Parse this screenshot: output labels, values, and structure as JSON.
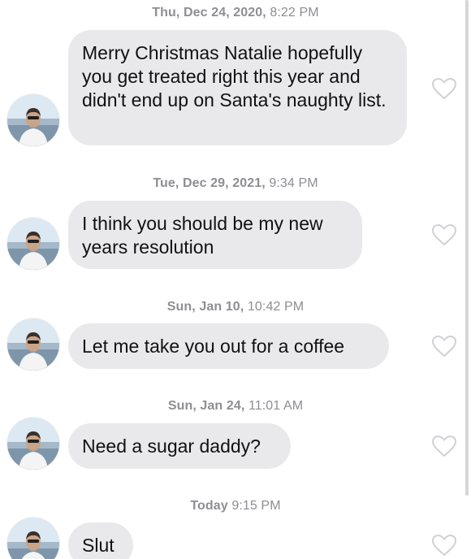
{
  "messages": [
    {
      "date": "Thu, Dec 24, 2020,",
      "time": "8:22 PM",
      "text": "Merry Christmas Natalie hopefully you get treated right this year and didn't end up on Santa's naughty list.",
      "liked": false
    },
    {
      "date": "Tue, Dec 29, 2021,",
      "time": "9:34 PM",
      "text": "I think you should be my new years resolution",
      "liked": false
    },
    {
      "date": "Sun, Jan 10,",
      "time": "10:42 PM",
      "text": "Let me take you out for a coffee",
      "liked": false
    },
    {
      "date": "Sun, Jan 24,",
      "time": "11:01 AM",
      "text": "Need a sugar daddy?",
      "liked": false
    },
    {
      "date": "Today",
      "time": "9:15 PM",
      "text": "Slut",
      "liked": false
    }
  ],
  "icons": {
    "avatar": "profile-photo",
    "like": "heart-outline-icon"
  },
  "colors": {
    "bubble": "#e9e9eb",
    "timestamp": "#8e8e93",
    "heart": "#d1d1d6"
  }
}
